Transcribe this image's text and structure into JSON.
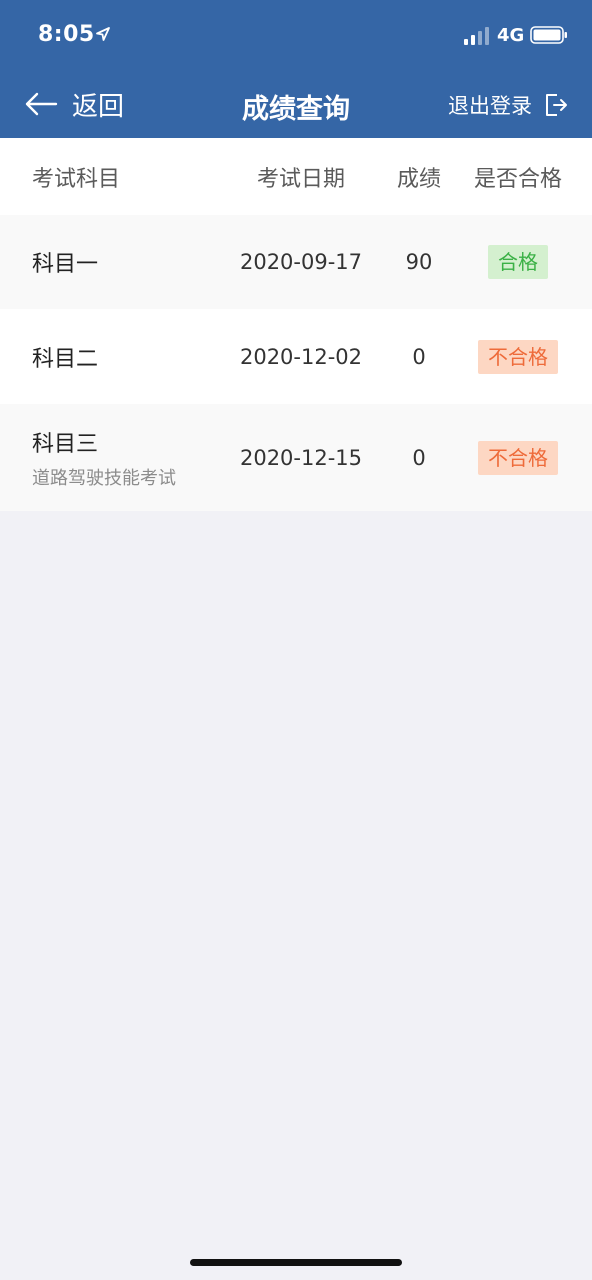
{
  "status_bar": {
    "time": "8:05",
    "network": "4G"
  },
  "nav": {
    "back_label": "返回",
    "title": "成绩查询",
    "logout_label": "退出登录"
  },
  "table": {
    "headers": {
      "subject": "考试科目",
      "date": "考试日期",
      "score": "成绩",
      "passed": "是否合格"
    },
    "rows": [
      {
        "subject": "科目一",
        "subtitle": "",
        "date": "2020-09-17",
        "score": "90",
        "status": "合格"
      },
      {
        "subject": "科目二",
        "subtitle": "",
        "date": "2020-12-02",
        "score": "0",
        "status": "不合格"
      },
      {
        "subject": "科目三",
        "subtitle": "道路驾驶技能考试",
        "date": "2020-12-15",
        "score": "0",
        "status": "不合格"
      }
    ]
  },
  "colors": {
    "header_bg": "#3566a6",
    "page_bg": "#f1f1f6",
    "pass_bg": "#d4f0cf",
    "pass_text": "#3bb146",
    "fail_bg": "#fdd7c3",
    "fail_text": "#ee6b3a"
  },
  "icons": {
    "location": "location-arrow-icon",
    "signal": "cellular-signal-icon",
    "battery": "battery-icon",
    "back": "back-arrow-icon",
    "logout": "logout-icon"
  }
}
